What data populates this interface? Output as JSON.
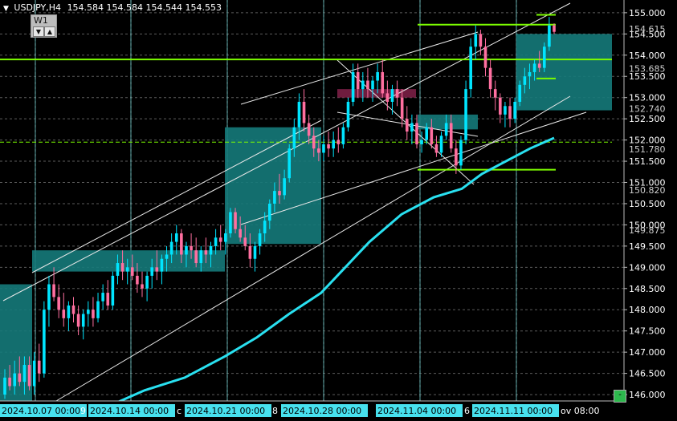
{
  "header": {
    "symbol_label": "USDJPY,H4",
    "ohlc": "154.584 154.584 154.544 154.553",
    "timeframe_button": "W1",
    "up_arrow": "▲",
    "down_arrow": "▼",
    "corner_button": "-"
  },
  "colors": {
    "background": "#000000",
    "bull": "#00e5ff",
    "bear": "#ff6fa0",
    "ma": "#29e0f0",
    "zone": "#157a7a",
    "zone_red": "#7a1f45",
    "level": "#7cfc00",
    "grid": "#5c5c5c"
  },
  "chart_data": {
    "type": "candlestick",
    "symbol": "USDJPY",
    "timeframe": "H4",
    "ylim": [
      145.85,
      155.3
    ],
    "y_ticks": [
      "155.000",
      "154.500",
      "154.000",
      "153.500",
      "153.000",
      "152.500",
      "152.000",
      "151.500",
      "151.000",
      "150.500",
      "150.000",
      "149.500",
      "149.000",
      "148.500",
      "148.000",
      "147.500",
      "147.000",
      "146.500",
      "146.000"
    ],
    "price_labels": [
      {
        "value": 154.615,
        "text": "154.615"
      },
      {
        "value": 153.685,
        "text": "153.685"
      },
      {
        "value": 152.74,
        "text": "152.740"
      },
      {
        "value": 151.78,
        "text": "151.780"
      },
      {
        "value": 150.82,
        "text": "150.820"
      },
      {
        "value": 149.875,
        "text": "149.875"
      }
    ],
    "x_labels": [
      {
        "text": "2024.10.07 00:00",
        "highlight": true
      },
      {
        "text": "9",
        "highlight": false
      },
      {
        "text": "2024.10.14 00:00",
        "highlight": true
      },
      {
        "text": "c",
        "highlight": false
      },
      {
        "text": "2024.10.21 00:00",
        "highlight": true
      },
      {
        "text": "8",
        "highlight": false
      },
      {
        "text": "2024.10.28 00:00",
        "highlight": true
      },
      {
        "text": "2024.11.04 00:00",
        "highlight": true
      },
      {
        "text": "6",
        "highlight": false
      },
      {
        "text": "2024.11.11 00:00",
        "highlight": true
      },
      {
        "text": "ov 08:00",
        "highlight": false
      }
    ],
    "candles": [
      [
        146.0,
        146.6,
        145.9,
        146.4
      ],
      [
        146.4,
        146.7,
        146.1,
        146.2
      ],
      [
        146.2,
        146.8,
        146.0,
        146.5
      ],
      [
        146.5,
        146.9,
        146.2,
        146.3
      ],
      [
        146.3,
        146.9,
        146.0,
        146.7
      ],
      [
        146.7,
        146.9,
        146.1,
        146.2
      ],
      [
        146.2,
        147.0,
        146.0,
        146.8
      ],
      [
        146.8,
        147.2,
        146.3,
        146.5
      ],
      [
        146.5,
        148.2,
        146.4,
        148.0
      ],
      [
        148.0,
        148.8,
        147.6,
        148.6
      ],
      [
        148.6,
        149.0,
        148.2,
        148.3
      ],
      [
        148.3,
        148.6,
        147.8,
        148.0
      ],
      [
        148.0,
        148.4,
        147.6,
        147.8
      ],
      [
        147.8,
        148.2,
        147.5,
        148.1
      ],
      [
        148.1,
        148.3,
        147.7,
        147.9
      ],
      [
        147.9,
        148.1,
        147.4,
        147.6
      ],
      [
        147.6,
        148.0,
        147.3,
        147.9
      ],
      [
        147.9,
        148.2,
        147.6,
        148.0
      ],
      [
        148.0,
        148.3,
        147.6,
        147.8
      ],
      [
        147.8,
        148.4,
        147.7,
        148.2
      ],
      [
        148.2,
        148.6,
        148.0,
        148.4
      ],
      [
        148.4,
        148.7,
        148.0,
        148.1
      ],
      [
        148.1,
        148.9,
        148.0,
        148.8
      ],
      [
        148.8,
        149.3,
        148.6,
        149.1
      ],
      [
        149.1,
        149.4,
        148.7,
        148.9
      ],
      [
        148.9,
        149.2,
        148.6,
        149.0
      ],
      [
        149.0,
        149.3,
        148.7,
        148.8
      ],
      [
        148.8,
        149.1,
        148.4,
        148.6
      ],
      [
        148.6,
        148.9,
        148.3,
        148.5
      ],
      [
        148.5,
        148.9,
        148.2,
        148.8
      ],
      [
        148.8,
        149.2,
        148.5,
        149.0
      ],
      [
        149.0,
        149.4,
        148.7,
        148.9
      ],
      [
        148.9,
        149.3,
        148.6,
        149.2
      ],
      [
        149.2,
        149.5,
        148.9,
        149.3
      ],
      [
        149.3,
        149.8,
        149.1,
        149.6
      ],
      [
        149.6,
        150.0,
        149.3,
        149.8
      ],
      [
        149.8,
        149.9,
        149.1,
        149.3
      ],
      [
        149.3,
        149.6,
        149.0,
        149.5
      ],
      [
        149.5,
        149.8,
        149.2,
        149.4
      ],
      [
        149.4,
        149.7,
        149.0,
        149.1
      ],
      [
        149.1,
        149.5,
        148.9,
        149.4
      ],
      [
        149.4,
        149.7,
        149.1,
        149.3
      ],
      [
        149.3,
        149.6,
        149.0,
        149.5
      ],
      [
        149.5,
        149.9,
        149.3,
        149.7
      ],
      [
        149.7,
        150.0,
        149.4,
        149.6
      ],
      [
        149.6,
        149.9,
        149.3,
        149.8
      ],
      [
        149.8,
        150.4,
        149.7,
        150.3
      ],
      [
        150.3,
        150.4,
        149.8,
        149.9
      ],
      [
        149.9,
        150.2,
        149.6,
        149.7
      ],
      [
        149.7,
        150.0,
        149.4,
        149.5
      ],
      [
        149.5,
        149.8,
        149.0,
        149.2
      ],
      [
        149.2,
        149.6,
        148.9,
        149.5
      ],
      [
        149.5,
        149.9,
        149.3,
        149.8
      ],
      [
        149.8,
        150.3,
        149.6,
        150.1
      ],
      [
        150.1,
        150.6,
        149.9,
        150.5
      ],
      [
        150.5,
        151.0,
        150.3,
        150.8
      ],
      [
        150.8,
        151.2,
        150.5,
        150.7
      ],
      [
        150.7,
        151.3,
        150.6,
        151.1
      ],
      [
        151.1,
        151.9,
        151.0,
        151.8
      ],
      [
        151.8,
        152.5,
        151.6,
        152.3
      ],
      [
        152.3,
        153.1,
        152.0,
        152.9
      ],
      [
        152.9,
        153.2,
        152.2,
        152.4
      ],
      [
        152.4,
        152.6,
        151.9,
        152.1
      ],
      [
        152.1,
        152.3,
        151.6,
        151.8
      ],
      [
        151.8,
        152.0,
        151.5,
        151.7
      ],
      [
        151.7,
        152.1,
        151.5,
        151.9
      ],
      [
        151.9,
        152.2,
        151.6,
        151.8
      ],
      [
        151.8,
        152.2,
        151.6,
        152.0
      ],
      [
        152.0,
        152.3,
        151.7,
        151.9
      ],
      [
        151.9,
        152.4,
        151.8,
        152.3
      ],
      [
        152.3,
        153.0,
        152.2,
        152.9
      ],
      [
        152.9,
        153.8,
        152.8,
        153.6
      ],
      [
        153.6,
        153.8,
        153.0,
        153.2
      ],
      [
        153.2,
        153.6,
        152.9,
        153.4
      ],
      [
        153.4,
        153.7,
        153.0,
        153.2
      ],
      [
        153.2,
        153.5,
        152.9,
        153.4
      ],
      [
        153.4,
        153.8,
        153.1,
        153.6
      ],
      [
        153.6,
        153.9,
        153.0,
        153.1
      ],
      [
        153.1,
        153.4,
        152.7,
        152.9
      ],
      [
        152.9,
        153.3,
        152.6,
        153.2
      ],
      [
        153.2,
        153.4,
        152.8,
        153.0
      ],
      [
        153.0,
        153.2,
        152.3,
        152.5
      ],
      [
        152.5,
        152.8,
        152.0,
        152.2
      ],
      [
        152.2,
        152.6,
        151.9,
        152.4
      ],
      [
        152.4,
        152.6,
        151.8,
        151.9
      ],
      [
        151.9,
        152.2,
        151.7,
        152.0
      ],
      [
        152.0,
        152.4,
        151.9,
        152.3
      ],
      [
        152.3,
        152.5,
        151.8,
        151.9
      ],
      [
        151.9,
        152.1,
        151.6,
        151.7
      ],
      [
        151.7,
        152.2,
        151.6,
        152.1
      ],
      [
        152.1,
        152.6,
        152.0,
        152.4
      ],
      [
        152.4,
        152.6,
        151.7,
        151.8
      ],
      [
        151.8,
        152.0,
        151.2,
        151.4
      ],
      [
        151.4,
        152.1,
        151.3,
        152.0
      ],
      [
        152.0,
        153.4,
        151.9,
        153.2
      ],
      [
        153.2,
        154.4,
        153.0,
        154.2
      ],
      [
        154.2,
        154.7,
        153.9,
        154.5
      ],
      [
        154.5,
        154.6,
        154.0,
        154.2
      ],
      [
        154.2,
        154.4,
        153.5,
        153.7
      ],
      [
        153.7,
        153.9,
        153.0,
        153.2
      ],
      [
        153.2,
        153.4,
        152.7,
        153.0
      ],
      [
        153.0,
        153.1,
        152.4,
        152.6
      ],
      [
        152.6,
        152.9,
        152.3,
        152.8
      ],
      [
        152.8,
        153.0,
        152.3,
        152.5
      ],
      [
        152.5,
        153.0,
        152.4,
        152.9
      ],
      [
        152.9,
        153.4,
        152.8,
        153.3
      ],
      [
        153.3,
        153.7,
        153.1,
        153.5
      ],
      [
        153.5,
        153.8,
        153.2,
        153.6
      ],
      [
        153.6,
        153.9,
        153.4,
        153.8
      ],
      [
        153.8,
        154.1,
        153.6,
        153.7
      ],
      [
        153.7,
        154.3,
        153.6,
        154.2
      ],
      [
        154.2,
        154.9,
        154.1,
        154.7
      ],
      [
        154.7,
        154.75,
        154.5,
        154.55
      ]
    ],
    "moving_average": [
      [
        0,
        145.0
      ],
      [
        60,
        145.1
      ],
      [
        120,
        145.6
      ],
      [
        180,
        146.1
      ],
      [
        230,
        146.4
      ],
      [
        280,
        146.9
      ],
      [
        320,
        147.35
      ],
      [
        360,
        147.9
      ],
      [
        400,
        148.4
      ],
      [
        430,
        149.0
      ],
      [
        460,
        149.6
      ],
      [
        500,
        150.25
      ],
      [
        540,
        150.65
      ],
      [
        575,
        150.85
      ],
      [
        600,
        151.2
      ],
      [
        630,
        151.5
      ],
      [
        660,
        151.8
      ],
      [
        690,
        152.05
      ]
    ],
    "ma_period_note": "",
    "horizontal_levels": [
      {
        "value": 153.9,
        "style": "solid",
        "from": 0,
        "to": 762
      },
      {
        "value": 151.95,
        "style": "dashed",
        "from": 0,
        "to": 762
      },
      {
        "value": 154.72,
        "style": "solid",
        "from": 520,
        "to": 692
      },
      {
        "value": 151.3,
        "style": "solid",
        "from": 520,
        "to": 692
      },
      {
        "value": 154.95,
        "style": "short",
        "from": 668,
        "to": 692
      },
      {
        "value": 153.45,
        "style": "short",
        "from": 668,
        "to": 692
      }
    ],
    "zones": [
      {
        "x0": 0,
        "x1": 40,
        "y_top": 148.6,
        "y_bot": 145.85,
        "kind": "teal"
      },
      {
        "x0": 40,
        "x1": 280,
        "y_top": 149.4,
        "y_bot": 148.9,
        "kind": "teal"
      },
      {
        "x0": 280,
        "x1": 400,
        "y_top": 152.3,
        "y_bot": 149.55,
        "kind": "teal"
      },
      {
        "x0": 520,
        "x1": 595,
        "y_top": 152.6,
        "y_bot": 152.25,
        "kind": "teal"
      },
      {
        "x0": 420,
        "x1": 518,
        "y_top": 153.2,
        "y_bot": 153.0,
        "kind": "red"
      },
      {
        "x0": 643,
        "x1": 762,
        "y_top": 154.5,
        "y_bot": 152.7,
        "kind": "teal"
      }
    ],
    "grid": true,
    "vertical_gridlines": true
  }
}
